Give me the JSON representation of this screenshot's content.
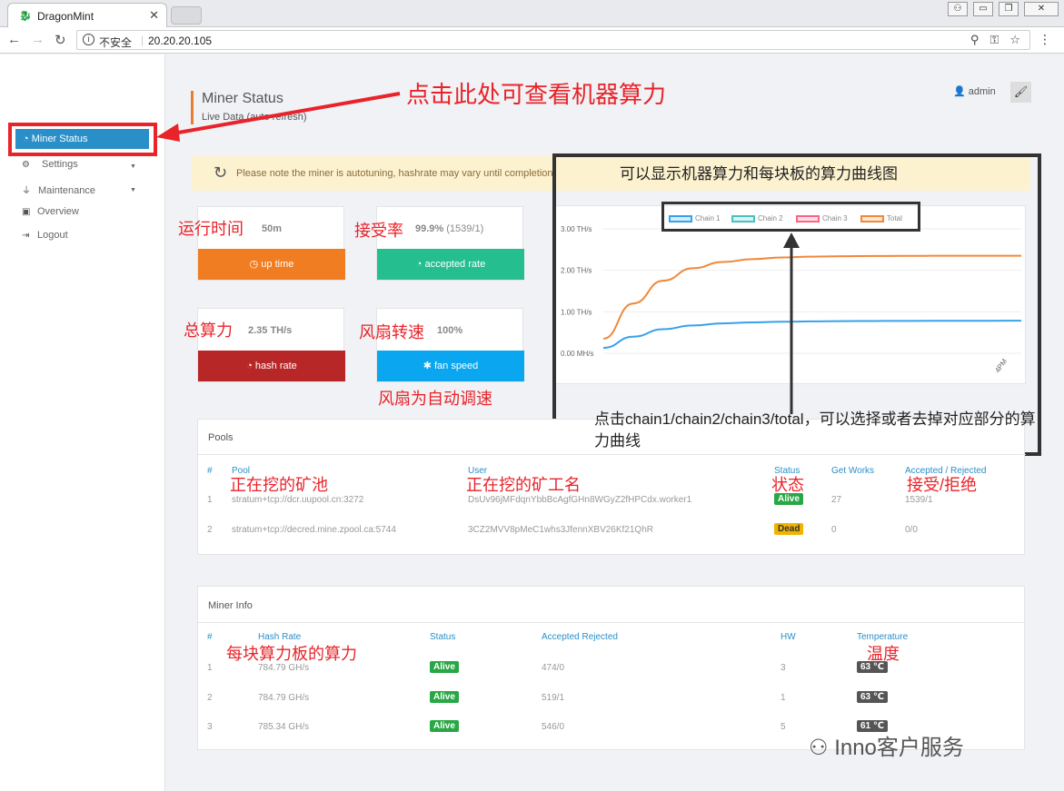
{
  "browser": {
    "tab_title": "DragonMint",
    "insecure_label": "不安全",
    "url": "20.20.20.105"
  },
  "sidebar": {
    "items": [
      {
        "label": "Miner Status",
        "icon": "gauge-icon"
      },
      {
        "label": "Settings",
        "icon": "gears-icon"
      },
      {
        "label": "Maintenance",
        "icon": "plug-icon"
      },
      {
        "label": "Overview",
        "icon": "chip-icon"
      },
      {
        "label": "Logout",
        "icon": "logout-icon"
      }
    ]
  },
  "header": {
    "title": "Miner Status",
    "subtitle": "Live Data (auto refresh)",
    "user": "admin"
  },
  "notice": "Please note the miner is autotuning, hashrate may vary until completion!",
  "cards": [
    {
      "value": "50m",
      "sub": "",
      "label": "up time",
      "color": "#f07d22",
      "icon": "clock-icon"
    },
    {
      "value": "99.9%",
      "sub": " (1539/1)",
      "label": "accepted rate",
      "color": "#25bf8f",
      "icon": "gauge-icon"
    },
    {
      "value": "2.35 TH/s",
      "sub": "",
      "label": "hash rate",
      "color": "#b82727",
      "icon": "gauge-icon"
    },
    {
      "value": "100%",
      "sub": "",
      "label": "fan speed",
      "color": "#0aa6ef",
      "icon": "snowflake-icon"
    }
  ],
  "chart_data": {
    "type": "line",
    "series": [
      {
        "name": "Chain 1",
        "color": "#36a2eb",
        "values": [
          0.13,
          0.4,
          0.58,
          0.67,
          0.72,
          0.745,
          0.76,
          0.77,
          0.775,
          0.778,
          0.78,
          0.782,
          0.783,
          0.784,
          0.785
        ]
      },
      {
        "name": "Chain 2",
        "color": "#4bc0c0",
        "values": []
      },
      {
        "name": "Chain 3",
        "color": "#ff6384",
        "values": []
      },
      {
        "name": "Total",
        "color": "#f0883a",
        "values": [
          0.35,
          1.2,
          1.75,
          2.05,
          2.2,
          2.27,
          2.31,
          2.33,
          2.34,
          2.345,
          2.348,
          2.35,
          2.35,
          2.35,
          2.35
        ]
      }
    ],
    "y_ticks": [
      "3.00 TH/s",
      "2.00 TH/s",
      "1.00 TH/s",
      "0.00 MH/s"
    ],
    "x_ticks": [
      "4PM"
    ],
    "ylim": [
      0,
      3
    ],
    "legend": "top"
  },
  "pools": {
    "title": "Pools",
    "headers": [
      "#",
      "Pool",
      "User",
      "Status",
      "Get Works",
      "Accepted / Rejected"
    ],
    "rows": [
      {
        "n": "1",
        "pool": "stratum+tcp://dcr.uupool.cn:3272",
        "user": "DsUv96jMFdqnYbbBcAgfGHn8WGyZ2fHPCdx.worker1",
        "status": "Alive",
        "works": "27",
        "ar": "1539/1"
      },
      {
        "n": "2",
        "pool": "stratum+tcp://decred.mine.zpool.ca:5744",
        "user": "3CZ2MVV8pMeC1whs3JfennXBV26Kf21QhR",
        "status": "Dead",
        "works": "0",
        "ar": "0/0"
      }
    ]
  },
  "miner_info": {
    "title": "Miner Info",
    "headers": [
      "#",
      "Hash Rate",
      "Status",
      "Accepted Rejected",
      "HW",
      "Temperature"
    ],
    "rows": [
      {
        "n": "1",
        "rate": "784.79 GH/s",
        "status": "Alive",
        "ar": "474/0",
        "hw": "3",
        "temp": "63 ℃"
      },
      {
        "n": "2",
        "rate": "784.79 GH/s",
        "status": "Alive",
        "ar": "519/1",
        "hw": "1",
        "temp": "63 ℃"
      },
      {
        "n": "3",
        "rate": "785.34 GH/s",
        "status": "Alive",
        "ar": "546/0",
        "hw": "5",
        "temp": "61 ℃"
      }
    ]
  },
  "annotations": {
    "click_here": "点击此处可查看机器算力",
    "uptime": "运行时间",
    "accept_rate": "接受率",
    "total_hash": "总算力",
    "fan_speed": "风扇转速",
    "fan_auto": "风扇为自动调速",
    "chart_desc": "可以显示机器算力和每块板的算力曲线图",
    "legend_desc": "点击chain1/chain2/chain3/total，可以选择或者去掉对应部分的算力曲线",
    "pool": "正在挖的矿池",
    "worker": "正在挖的矿工名",
    "status": "状态",
    "accept_reject": "接受/拒绝",
    "board_hash": "每块算力板的算力",
    "temperature": "温度",
    "watermark": "Inno客户服务"
  }
}
